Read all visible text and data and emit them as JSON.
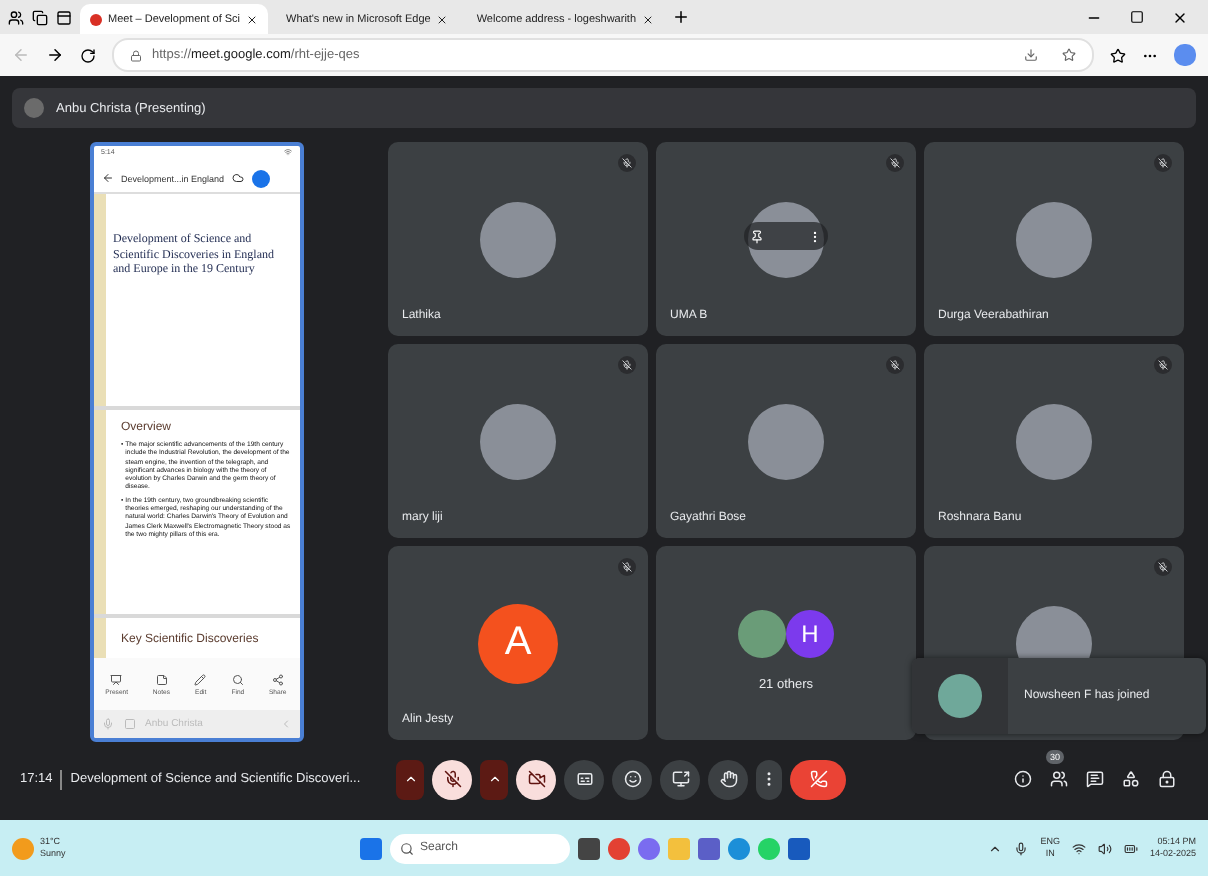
{
  "browser": {
    "tabs": [
      {
        "title": "Meet – Development of Sci",
        "selected": true,
        "recording": true
      },
      {
        "title": "What's new in Microsoft Edge",
        "selected": false,
        "recording": false
      },
      {
        "title": "Welcome address - logeshwarith",
        "selected": false,
        "recording": false
      }
    ],
    "url_host": "meet.google.com",
    "url_scheme": "https://",
    "url_path": "/rht-ejje-qes"
  },
  "presenter": {
    "label": "Anbu Christa (Presenting)"
  },
  "shared_screen": {
    "status_time": "5:14",
    "doc_title": "Development...in England",
    "slides": [
      {
        "kind": "title",
        "text": "Development of Science and Scientific Discoveries in England and Europe in the  19 Century"
      },
      {
        "kind": "content",
        "heading": "Overview",
        "bullets": [
          {
            "mark": "•",
            "text": "The major scientific advancements of the 19th century include the Industrial Revolution, the development of the steam engine, the invention of the telegraph, and significant advances in biology with the theory of evolution by Charles Darwin and the germ theory of disease."
          },
          {
            "mark": "•",
            "text": "In the 19th century, two groundbreaking scientific theories emerged, reshaping our understanding of the natural world: Charles Darwin's Theory of Evolution and James Clerk Maxwell's Electromagnetic Theory stood as the two mighty pillars of this era."
          }
        ]
      },
      {
        "kind": "cut",
        "heading": "Key Scientific Discoveries"
      }
    ],
    "toolbar": [
      "Present",
      "Notes",
      "Edit",
      "Find",
      "Share"
    ],
    "footer_name": "Anbu Christa"
  },
  "tiles": [
    {
      "kind": "photo",
      "name": "Lathika",
      "muted": true,
      "hovered": false
    },
    {
      "kind": "photo",
      "name": "UMA B",
      "muted": true,
      "hovered": true
    },
    {
      "kind": "photo",
      "name": "Durga Veerabathiran",
      "muted": true,
      "hovered": false
    },
    {
      "kind": "photo",
      "name": "mary liji",
      "muted": true,
      "hovered": false
    },
    {
      "kind": "photo",
      "name": "Gayathri Bose",
      "muted": true,
      "hovered": false
    },
    {
      "kind": "photo",
      "name": "Roshnara Banu",
      "muted": true,
      "hovered": false
    },
    {
      "kind": "letter",
      "name": "Alin Jesty",
      "letter": "A",
      "color": "#f4511e",
      "muted": true,
      "hovered": false
    },
    {
      "kind": "group",
      "name": "21 others",
      "letter": "H",
      "color": "#7c3aed"
    },
    {
      "kind": "photo",
      "muted": true
    }
  ],
  "toast": {
    "text": "Nowsheen F has joined"
  },
  "controls": {
    "time": "17:14",
    "meeting_title": "Development of Science and Scientific Discoveri...",
    "mic_on": false,
    "camera_on": false,
    "participant_count": "30"
  },
  "taskbar": {
    "temperature": "31°C",
    "weather": "Sunny",
    "search_placeholder": "Search",
    "lang": "ENG",
    "region": "IN",
    "time": "05:14 PM",
    "date": "14-02-2025"
  }
}
